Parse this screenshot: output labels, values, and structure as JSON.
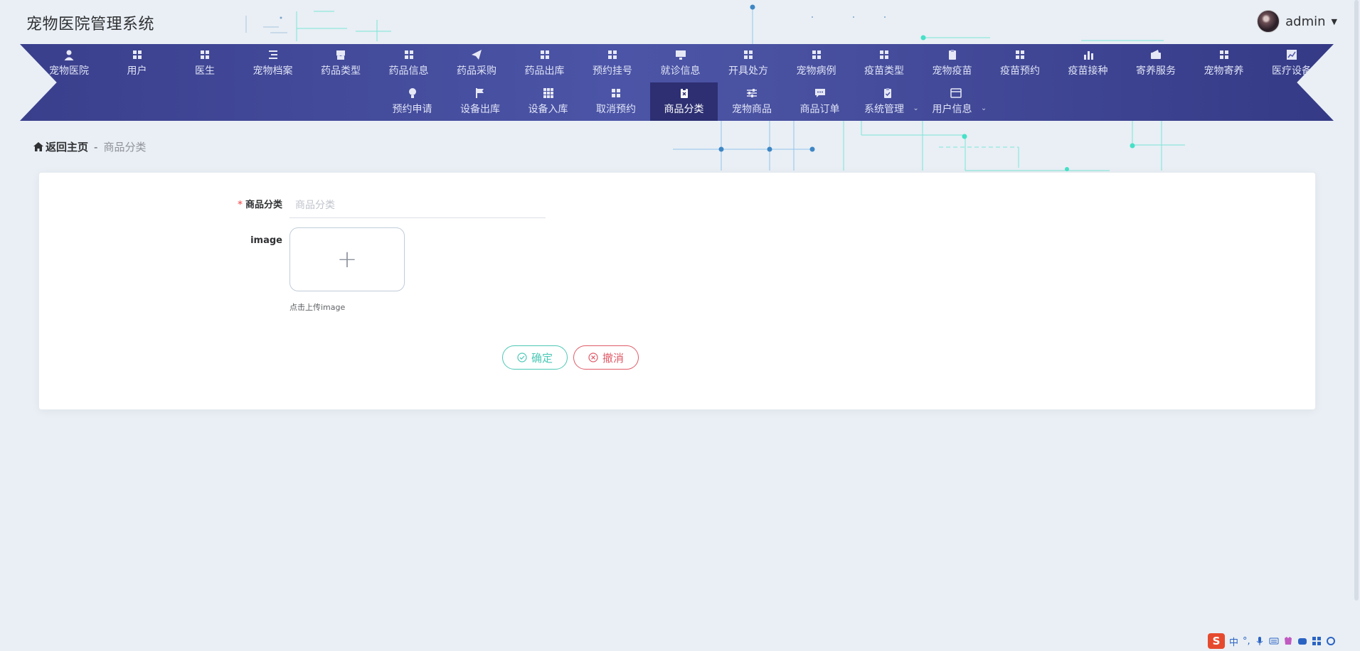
{
  "app": {
    "title": "宠物医院管理系统"
  },
  "user": {
    "name": "admin"
  },
  "nav": {
    "row1": [
      {
        "label": "宠物医院",
        "icon": "user-icon"
      },
      {
        "label": "用户",
        "icon": "grid-icon"
      },
      {
        "label": "医生",
        "icon": "grid-icon"
      },
      {
        "label": "宠物档案",
        "icon": "list-icon"
      },
      {
        "label": "药品类型",
        "icon": "shop-icon"
      },
      {
        "label": "药品信息",
        "icon": "grid-icon"
      },
      {
        "label": "药品采购",
        "icon": "paper-plane-icon"
      },
      {
        "label": "药品出库",
        "icon": "grid-icon"
      },
      {
        "label": "预约挂号",
        "icon": "grid-icon"
      },
      {
        "label": "就诊信息",
        "icon": "monitor-icon"
      },
      {
        "label": "开具处方",
        "icon": "grid-icon"
      },
      {
        "label": "宠物病例",
        "icon": "grid-icon"
      },
      {
        "label": "疫苗类型",
        "icon": "grid-icon"
      },
      {
        "label": "宠物疫苗",
        "icon": "clipboard-icon"
      },
      {
        "label": "疫苗预约",
        "icon": "grid-icon"
      },
      {
        "label": "疫苗接种",
        "icon": "bar-chart-icon"
      },
      {
        "label": "寄养服务",
        "icon": "wallet-icon"
      },
      {
        "label": "宠物寄养",
        "icon": "grid-icon"
      },
      {
        "label": "医疗设备",
        "icon": "line-chart-icon"
      }
    ],
    "row2": [
      {
        "label": "预约申请",
        "icon": "bulb-icon"
      },
      {
        "label": "设备出库",
        "icon": "flag-icon"
      },
      {
        "label": "设备入库",
        "icon": "grid9-icon"
      },
      {
        "label": "取消预约",
        "icon": "grid-icon"
      },
      {
        "label": "商品分类",
        "icon": "clipboard-x-icon"
      },
      {
        "label": "宠物商品",
        "icon": "sliders-icon"
      },
      {
        "label": "商品订单",
        "icon": "chat-icon"
      },
      {
        "label": "系统管理",
        "icon": "clipboard-check-icon"
      },
      {
        "label": "用户信息",
        "icon": "card-icon"
      }
    ]
  },
  "breadcrumb": {
    "home": "返回主页",
    "separator": "-",
    "current": "商品分类"
  },
  "form": {
    "category_label": "商品分类",
    "category_placeholder": "商品分类",
    "image_label": "image",
    "upload_tip": "点击上传image",
    "confirm": "确定",
    "cancel": "撤消"
  },
  "ime": {
    "lang": "中"
  },
  "colors": {
    "nav_start": "#3a3f8c",
    "nav_active": "#2d2f72",
    "confirm": "#4cc8b6",
    "cancel": "#e05a67"
  }
}
